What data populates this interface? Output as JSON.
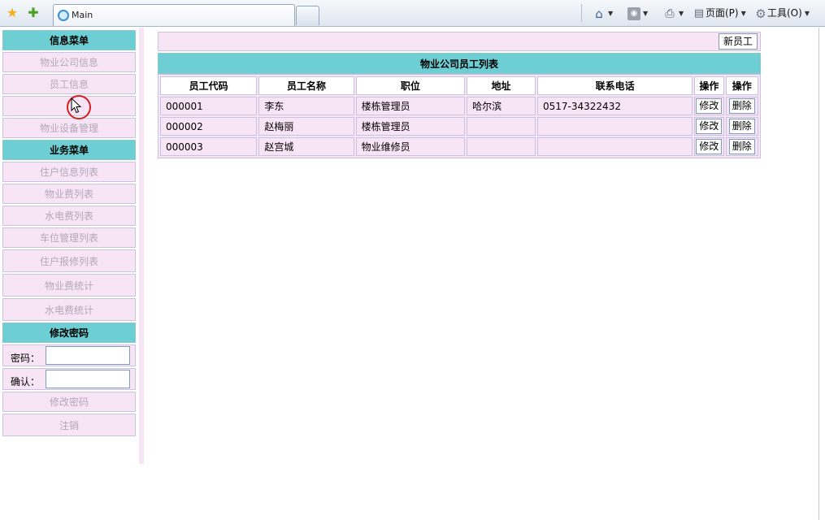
{
  "browser": {
    "tab_title": "Main",
    "commands": {
      "page_label": "页面(P)",
      "tools_label": "工具(O)"
    }
  },
  "sidebar": {
    "info_menu_title": "信息菜单",
    "info_items": [
      "物业公司信息",
      "员工信息",
      "",
      "物业设备管理"
    ],
    "business_menu_title": "业务菜单",
    "business_items": [
      "住户信息列表",
      "物业费列表",
      "水电费列表",
      "车位管理列表",
      "住户报修列表",
      "物业费统计",
      "水电费统计"
    ],
    "password_title": "修改密码",
    "password_label": "密码：",
    "confirm_label": "确认：",
    "change_password_label": "修改密码",
    "logout_label": "注销"
  },
  "main": {
    "new_employee_button": "新员工",
    "list_title": "物业公司员工列表",
    "columns": [
      "员工代码",
      "员工名称",
      "职位",
      "地址",
      "联系电话",
      "操作",
      "操作"
    ],
    "rows": [
      {
        "code": "000001",
        "name": "李东",
        "position": "楼栋管理员",
        "address": "哈尔滨",
        "phone": "0517-34322432",
        "edit": "修改",
        "delete": "删除"
      },
      {
        "code": "000002",
        "name": "赵梅丽",
        "position": "楼栋管理员",
        "address": "",
        "phone": "",
        "edit": "修改",
        "delete": "删除"
      },
      {
        "code": "000003",
        "name": "赵宫城",
        "position": "物业维修员",
        "address": "",
        "phone": "",
        "edit": "修改",
        "delete": "删除"
      }
    ]
  },
  "colors": {
    "header_teal": "#6dcfd3",
    "row_pink": "#f7e4f5",
    "menu_text_gray": "#b2a8b8"
  },
  "icons": {
    "favorites": "star-icon",
    "add_favorites": "add-favorite-icon",
    "home": "home-icon",
    "feeds": "feed-icon",
    "print": "printer-icon",
    "page": "page-icon",
    "tools": "gear-icon"
  }
}
